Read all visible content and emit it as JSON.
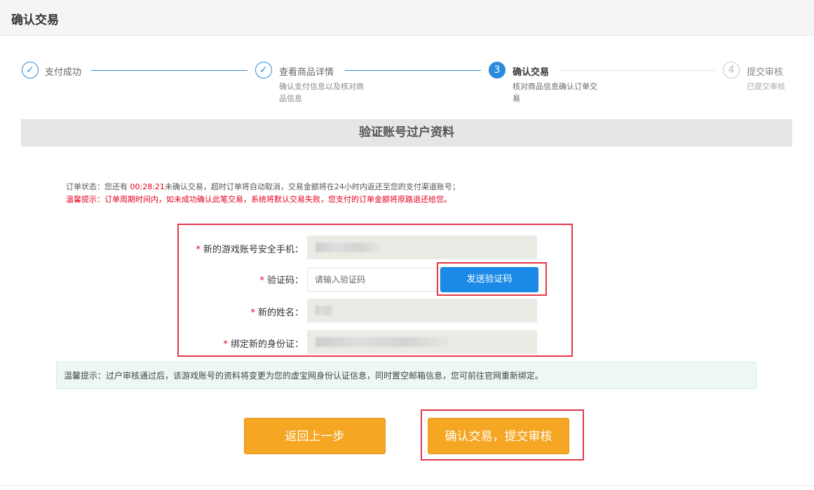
{
  "header": {
    "title": "确认交易"
  },
  "steps": [
    {
      "number": "✓",
      "label": "支付成功",
      "desc": "",
      "state": "done"
    },
    {
      "number": "✓",
      "label": "查看商品详情",
      "desc": "确认支付信息以及核对商品信息",
      "state": "done"
    },
    {
      "number": "3",
      "label": "确认交易",
      "desc": "核对商品信息确认订单交易",
      "state": "active"
    },
    {
      "number": "4",
      "label": "提交审核",
      "desc": "已提交审核",
      "state": "todo"
    }
  ],
  "section": {
    "title": "验证账号过户资料"
  },
  "status": {
    "prefix": "订单状态：您还有 ",
    "time": "00:28:21",
    "suffix": "未确认交易，超时订单将自动取消，交易金额将在24小时内返还至您的支付渠道账号；",
    "warning": "温馨提示：订单周期时间内，如未成功确认此笔交易，系统将默认交易失败，您支付的订单金额将原路退还给您。"
  },
  "form": {
    "required_mark": "*",
    "phone_label": "新的游戏账号安全手机：",
    "code_label": "验证码：",
    "code_placeholder": "请输入验证码",
    "send_code_label": "发送验证码",
    "name_label": "新的姓名：",
    "id_label": "绑定新的身份证："
  },
  "tip": {
    "text": "温馨提示：过户审核通过后，该游戏账号的资料将变更为您的虚宝网身份认证信息，同时置空邮箱信息，您可前往官网重新绑定。"
  },
  "buttons": {
    "back_label": "返回上一步",
    "confirm_label": "确认交易，提交审核"
  },
  "colors": {
    "primary_blue": "#1a8ae6",
    "orange": "#f5a623",
    "highlight_red": "#e5374a",
    "alert_red": "#e5001f"
  }
}
